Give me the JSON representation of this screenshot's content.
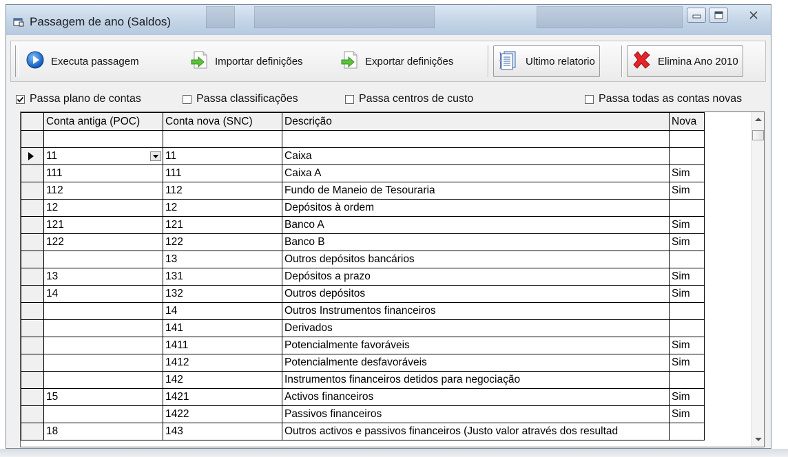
{
  "window": {
    "title": "Passagem de ano (Saldos)"
  },
  "toolbar": {
    "execute_label": "Executa passagem",
    "import_label": "Importar definições",
    "export_label": "Exportar definições",
    "report_label": "Ultimo relatorio",
    "delete_label": "Elimina Ano 2010"
  },
  "options": {
    "plano": {
      "label": "Passa plano de contas",
      "checked": true
    },
    "classificacoes": {
      "label": "Passa classificações",
      "checked": false
    },
    "centros": {
      "label": "Passa centros de custo",
      "checked": false
    },
    "todas": {
      "label": "Passa todas as contas novas",
      "checked": false
    }
  },
  "grid": {
    "headers": [
      "Conta antiga (POC)",
      "Conta nova (SNC)",
      "Descrição",
      "Nova"
    ],
    "rows": [
      [
        "",
        "",
        "",
        ""
      ],
      [
        "11",
        "11",
        "Caixa",
        ""
      ],
      [
        "111",
        "111",
        "Caixa A",
        "Sim"
      ],
      [
        "112",
        "112",
        "Fundo de Maneio de Tesouraria",
        "Sim"
      ],
      [
        "12",
        "12",
        "Depósitos à ordem",
        ""
      ],
      [
        "121",
        "121",
        "Banco A",
        "Sim"
      ],
      [
        "122",
        "122",
        "Banco B",
        "Sim"
      ],
      [
        "",
        "13",
        "Outros depósitos bancários",
        ""
      ],
      [
        "13",
        "131",
        "Depósitos a prazo",
        "Sim"
      ],
      [
        "14",
        "132",
        "Outros depósitos",
        "Sim"
      ],
      [
        "",
        "14",
        "Outros Instrumentos financeiros",
        ""
      ],
      [
        "",
        "141",
        "Derivados",
        ""
      ],
      [
        "",
        "1411",
        "Potencialmente favoráveis",
        "Sim"
      ],
      [
        "",
        "1412",
        "Potencialmente desfavoráveis",
        "Sim"
      ],
      [
        "",
        "142",
        "Instrumentos financeiros detidos para negociação",
        ""
      ],
      [
        "15",
        "1421",
        "Activos financeiros",
        "Sim"
      ],
      [
        "",
        "1422",
        "Passivos financeiros",
        "Sim"
      ],
      [
        "18",
        "143",
        "Outros activos e passivos financeiros (Justo valor através dos resultad",
        ""
      ]
    ]
  }
}
